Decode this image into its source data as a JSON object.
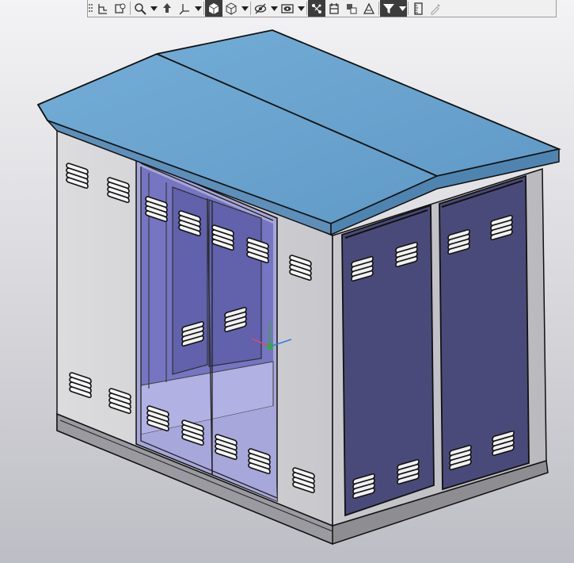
{
  "app": {
    "type": "3D CAD viewer"
  },
  "toolbar": {
    "buttons": [
      {
        "icon": "toolbar-grip-icon",
        "active": false
      },
      {
        "icon": "sketch-plane-icon",
        "active": false
      },
      {
        "icon": "orientation-icon",
        "active": false
      },
      {
        "icon": "zoom-icon",
        "active": false,
        "dropdown": true
      },
      {
        "icon": "rotate-icon",
        "active": false
      },
      {
        "icon": "pan-axes-icon",
        "active": false,
        "dropdown": true
      },
      {
        "icon": "solid-shaded-icon",
        "active": true
      },
      {
        "icon": "wireframe-icon",
        "active": false,
        "dropdown": true
      },
      {
        "icon": "hide-icon",
        "active": false,
        "dropdown": true
      },
      {
        "icon": "show-icon",
        "active": false,
        "dropdown": true
      },
      {
        "icon": "component-link-icon",
        "active": true
      },
      {
        "icon": "section-view-icon",
        "active": false
      },
      {
        "icon": "explode-icon",
        "active": false
      },
      {
        "icon": "render-icon",
        "active": false
      },
      {
        "icon": "filter-icon",
        "active": true,
        "dropdown": true
      },
      {
        "icon": "measure-icon",
        "active": false
      },
      {
        "icon": "eyedropper-icon",
        "active": false
      }
    ]
  },
  "model": {
    "name": "box-type-substation",
    "colors": {
      "roof": "#6fa9d2",
      "roof_dark": "#5b93bf",
      "wall": "#d4d4d6",
      "door": "#4a4a7a",
      "glass": "#9b9be0",
      "base": "#8d8d92"
    }
  }
}
